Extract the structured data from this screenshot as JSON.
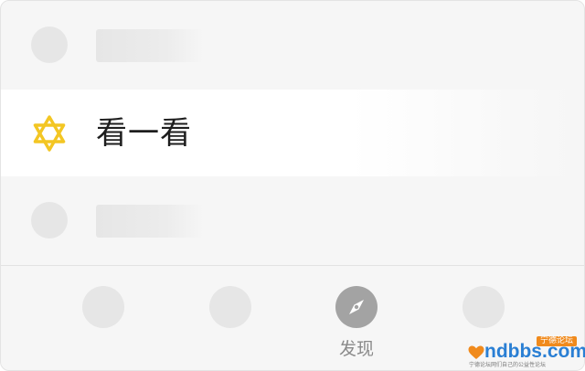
{
  "list": {
    "active_item": {
      "label": "看一看",
      "icon": "star-of-david-icon"
    }
  },
  "tabbar": {
    "active_tab": {
      "label": "发现",
      "icon": "compass-icon"
    }
  },
  "watermark": {
    "tag": "宁德论坛",
    "text": "ndbbs.com",
    "subtext": "宁德论坛网们自己的公益性论坛"
  },
  "colors": {
    "background": "#f6f6f6",
    "active_row": "#ffffff",
    "placeholder": "#e6e6e6",
    "icon_gold": "#f3c623",
    "active_tab_icon": "#a3a3a3",
    "watermark_blue": "#2a7fd4",
    "watermark_orange": "#f08a1c"
  }
}
